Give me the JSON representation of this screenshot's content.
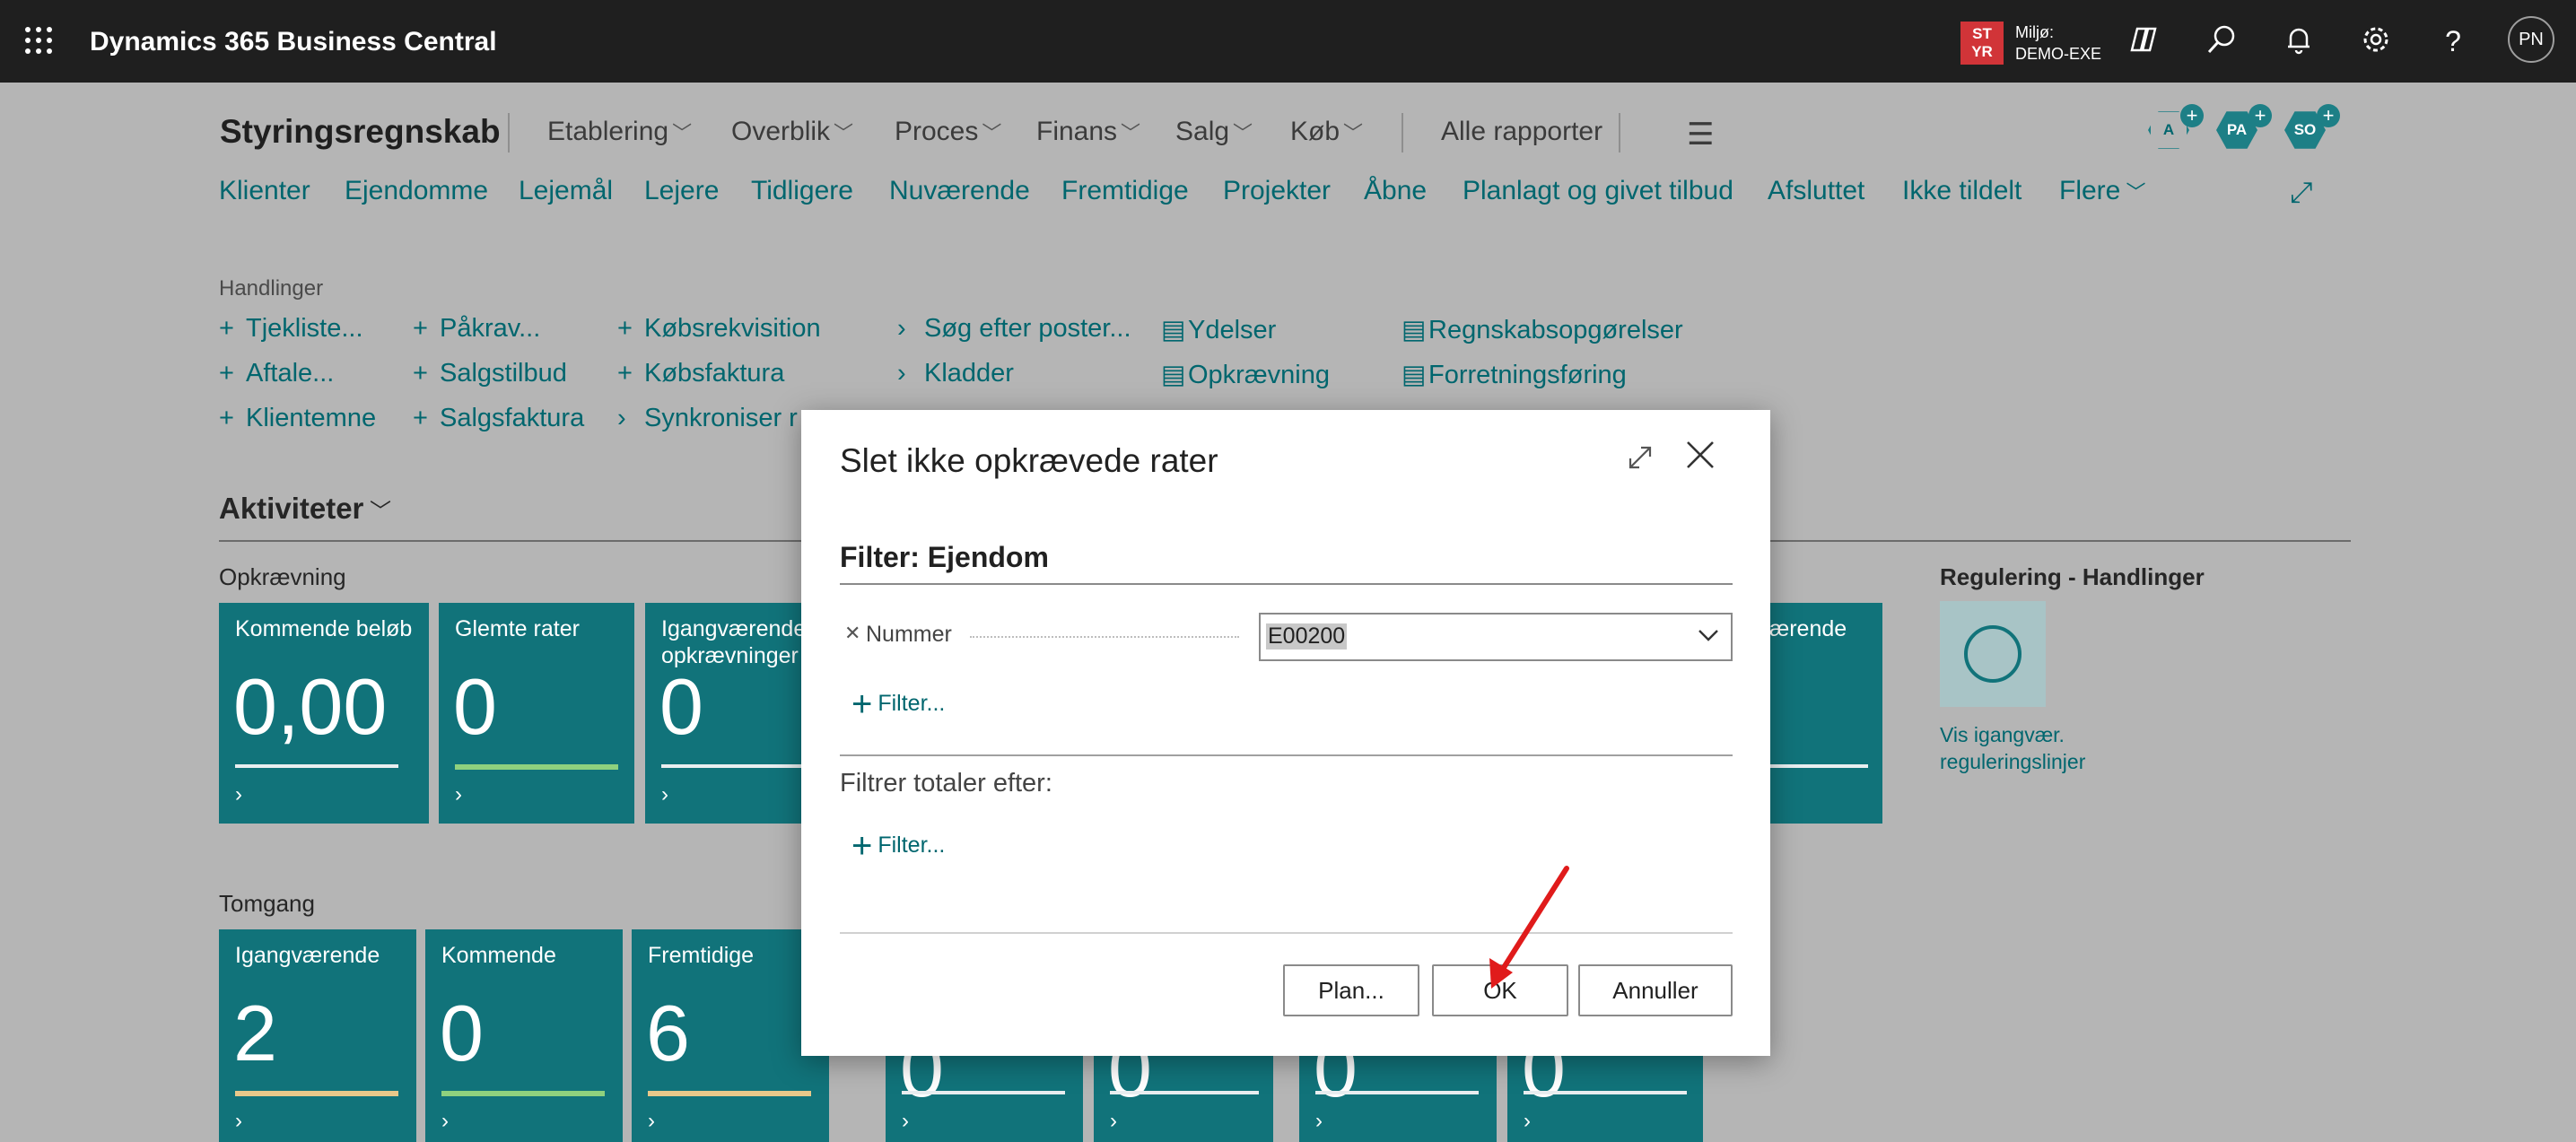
{
  "topbar": {
    "app_title": "Dynamics 365 Business Central",
    "env_badge": "ST\nYR",
    "env_label_line1": "Miljø:",
    "env_label_line2": "DEMO-EXE",
    "avatar": "PN",
    "icons": [
      "waffle-icon",
      "copilot-icon",
      "search-icon",
      "bell-icon",
      "gear-icon",
      "help-icon"
    ]
  },
  "page": {
    "title": "Styringsregnskab",
    "menu": [
      "Etablering",
      "Overblik",
      "Proces",
      "Finans",
      "Salg",
      "Køb"
    ],
    "all_reports": "Alle rapporter",
    "nav_links": [
      "Klienter",
      "Ejendomme",
      "Lejemål",
      "Lejere",
      "Tidligere",
      "Nuværende",
      "Fremtidige",
      "Projekter",
      "Åbne",
      "Planlagt og givet tilbud",
      "Afsluttet",
      "Ikke tildelt",
      "Flere"
    ],
    "hex_buttons": [
      "A",
      "PA",
      "SO"
    ],
    "actions_label": "Handlinger",
    "actions": {
      "col1": [
        "Tjekliste...",
        "Aftale...",
        "Klientemne"
      ],
      "col2": [
        "Påkrav...",
        "Salgstilbud",
        "Salgsfaktura"
      ],
      "col3": [
        "Købsrekvisition",
        "Købsfaktura",
        "Synkroniser r"
      ],
      "col4": [
        "Søg efter poster...",
        "Kladder"
      ],
      "col5": [
        "Ydelser",
        "Opkrævning"
      ],
      "col6": [
        "Regnskabsopgørelser",
        "Forretningsføring"
      ]
    },
    "activities_title": "Aktiviteter",
    "groups": {
      "opkraevning": "Opkrævning",
      "tomgang": "Tomgang",
      "regulering": "Regulering - Handlinger"
    },
    "tiles_opkraevning": [
      {
        "label": "Kommende beløb",
        "value": "0,00"
      },
      {
        "label": "Glemte rater",
        "value": "0"
      },
      {
        "label": "Igangværende opkrævninger",
        "value": "0"
      },
      {
        "label": "ærende",
        "value": ""
      }
    ],
    "tiles_tomgang": [
      {
        "label": "Igangværende",
        "value": "2"
      },
      {
        "label": "Kommende",
        "value": "0"
      },
      {
        "label": "Fremtidige",
        "value": "6"
      },
      {
        "label": "",
        "value": "0"
      },
      {
        "label": "",
        "value": "0"
      },
      {
        "label": "",
        "value": "0"
      },
      {
        "label": "",
        "value": "0"
      }
    ],
    "reg_link": "Vis igangvær. reguleringslinjer",
    "colors": {
      "accent": "#11737a",
      "link": "#00666e",
      "bar_green": "#8fd17e",
      "bar_yellow": "#e8c88a"
    }
  },
  "dialog": {
    "title": "Slet ikke opkrævede rater",
    "filter_section_title": "Filter: Ejendom",
    "field_label": "Nummer",
    "field_value": "E00200",
    "add_filter": "Filter...",
    "totals_label": "Filtrer totaler efter:",
    "add_filter_totals": "Filter...",
    "buttons": {
      "plan": "Plan...",
      "ok": "OK",
      "cancel": "Annuller"
    }
  }
}
